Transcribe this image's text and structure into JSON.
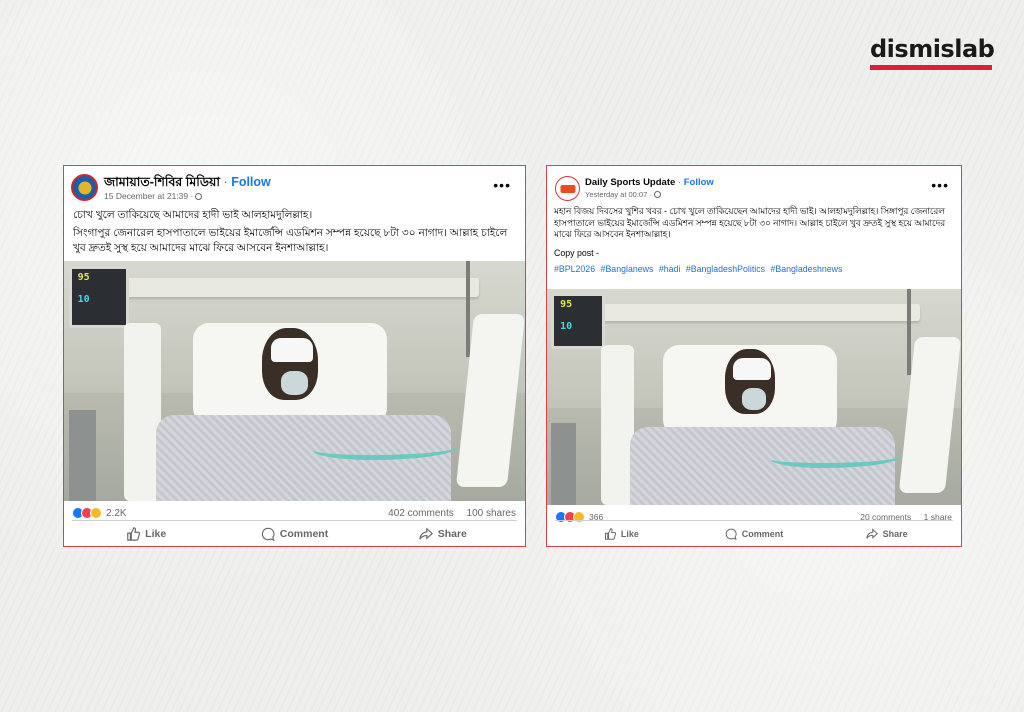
{
  "brand": {
    "name": "dismislab",
    "accent_color": "#d6232f"
  },
  "posts": [
    {
      "page_name": "জামায়াত-শিবির মিডিয়া",
      "separator": "·",
      "follow_label": "Follow",
      "timestamp": "15 December at 21:39 ·",
      "avatar_icon": "page-avatar-icon",
      "body": [
        "চোখ খুলে তাকিয়েছে আমাদের হাদী ভাই আলহামদুলিল্লাহ।",
        "সিংগাপুর জেনারেল হাসপাতালে ভাইয়ের ইমার্জেন্সি এডমিশন সম্পন্ন হয়েছে ৮টা ৩০ নাগাদ। আল্লাহ চাইলে খুব দ্রুতই সুস্থ হয়ে আমাদের মাঝে ফিরে আসবেন ইনশাআল্লাহ।"
      ],
      "monitor_top": "95",
      "monitor_bottom": "10",
      "reactions_count": "2.2K",
      "comments": "402 comments",
      "shares": "100 shares",
      "actions": {
        "like": "Like",
        "comment": "Comment",
        "share": "Share"
      }
    },
    {
      "page_name": "Daily Sports Update",
      "separator": "·",
      "follow_label": "Follow",
      "timestamp": "Yesterday at 00:07 ·",
      "avatar_icon": "page-avatar-icon",
      "body": [
        "মহান বিজয় দিবসের খুশির খবর - চোখ খুলে তাকিয়েছেন আমাদের হাদী ভাই। আলহামদুলিল্লাহ। সিঙ্গাপুর জেনারেল হাসপাতালে ভাইয়ের ইমার্জেন্সি এডমিশন সম্পন্ন হয়েছে ৮টা ৩০ নাগাদ। আল্লাহ চাইলে খুব দ্রুতই সুস্থ হয়ে আমাদের মাঝে ফিরে আসবেন ইনশাআল্লাহ।"
      ],
      "copy_label": "Copy post -",
      "hashtags": [
        "#BPL2026",
        "#Banglanews",
        "#hadi",
        "#BangladeshPolitics",
        "#Bangladeshnews"
      ],
      "monitor_top": "95",
      "monitor_bottom": "10",
      "reactions_count": "366",
      "comments": "20 comments",
      "shares": "1 share",
      "actions": {
        "like": "Like",
        "comment": "Comment",
        "share": "Share"
      }
    }
  ]
}
